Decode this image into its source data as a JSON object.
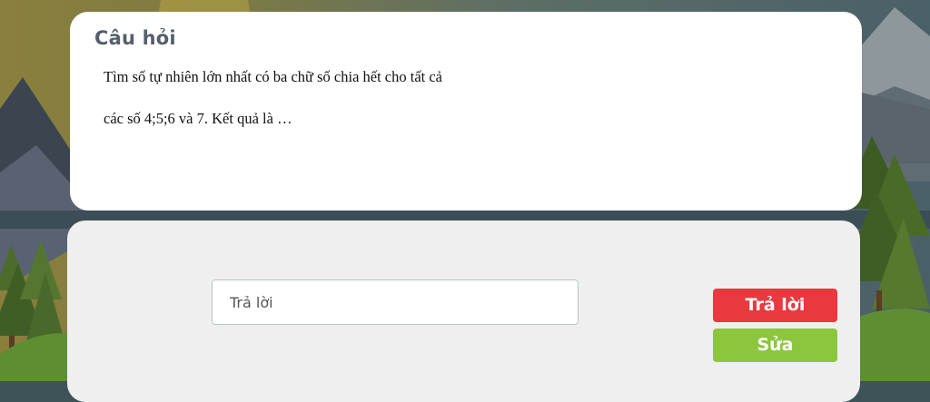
{
  "question": {
    "title": "Câu hỏi",
    "text_line1": "Tìm số tự nhiên lớn nhất có ba chữ số chia hết cho tất cả",
    "text_line2": "các số 4;5;6 và 7. Kết quả là …"
  },
  "answer": {
    "input_placeholder": "Trả lời",
    "input_value": "",
    "submit_label": "Trả lời",
    "edit_label": "Sửa"
  },
  "colors": {
    "submit_button": "#e8393f",
    "edit_button": "#8cc63f",
    "title_text": "#55606c",
    "panel_background": "#efefef"
  },
  "background": {
    "scene": "mountain-forest-landscape"
  }
}
